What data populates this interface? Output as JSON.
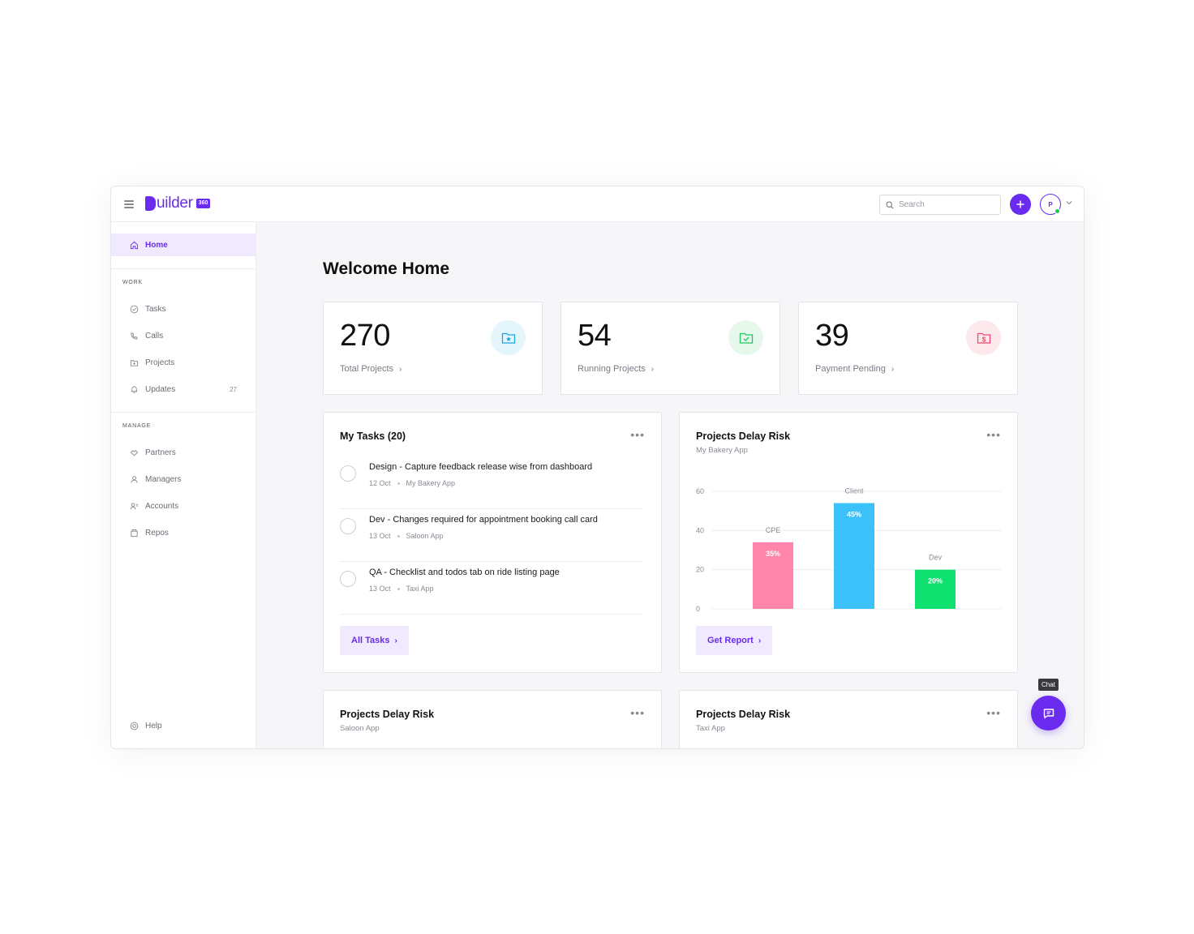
{
  "app": {
    "brand_name": "uilder",
    "brand_badge": "360",
    "brand_color": "#6a2bef"
  },
  "header": {
    "search_placeholder": "Search",
    "avatar_initial": "P"
  },
  "sidebar": {
    "home_label": "Home",
    "work_title": "WORK",
    "work_items": [
      {
        "label": "Tasks",
        "icon": "check-circle-icon"
      },
      {
        "label": "Calls",
        "icon": "phone-icon"
      },
      {
        "label": "Projects",
        "icon": "folder-icon"
      },
      {
        "label": "Updates",
        "icon": "bell-icon",
        "count": "27"
      }
    ],
    "manage_title": "MANAGE",
    "manage_items": [
      {
        "label": "Partners",
        "icon": "handshake-icon"
      },
      {
        "label": "Managers",
        "icon": "user-icon"
      },
      {
        "label": "Accounts",
        "icon": "users-icon"
      },
      {
        "label": "Repos",
        "icon": "archive-icon"
      }
    ],
    "help_label": "Help"
  },
  "main": {
    "welcome": "Welcome Home",
    "stats": [
      {
        "value": "270",
        "label": "Total Projects",
        "icon": "folder-star-icon",
        "icon_color": "#1aa7dd",
        "icon_bg": "#e5f5fc"
      },
      {
        "value": "54",
        "label": "Running Projects",
        "icon": "folder-check-icon",
        "icon_color": "#22c55e",
        "icon_bg": "#e6f8ec"
      },
      {
        "value": "39",
        "label": "Payment Pending",
        "icon": "folder-dollar-icon",
        "icon_color": "#ef476f",
        "icon_bg": "#fde8ec"
      }
    ],
    "tasks": {
      "title": "My Tasks (20)",
      "items": [
        {
          "title": "Design - Capture feedback release wise from dashboard",
          "date": "12 Oct",
          "project": "My Bakery App"
        },
        {
          "title": "Dev - Changes required for appointment booking call card",
          "date": "13 Oct",
          "project": "Saloon App"
        },
        {
          "title": "QA - Checklist and todos tab on ride listing page",
          "date": "13 Oct",
          "project": "Taxi App"
        }
      ],
      "button": "All Tasks"
    },
    "risk": {
      "title": "Projects Delay Risk",
      "subtitle": "My Bakery App",
      "button": "Get Report"
    },
    "risk2": {
      "title": "Projects Delay Risk",
      "subtitle": "Saloon App"
    },
    "risk3": {
      "title": "Projects Delay Risk",
      "subtitle": "Taxi App"
    }
  },
  "chart_data": {
    "type": "bar",
    "categories": [
      "CPE",
      "Client",
      "Dev"
    ],
    "values": [
      34,
      54,
      20
    ],
    "data_labels": [
      "35%",
      "45%",
      "20%"
    ],
    "colors": [
      "#ff85aa",
      "#3cc1fa",
      "#0fe070"
    ],
    "ylim": [
      0,
      60
    ],
    "yticks": [
      0,
      20,
      40,
      60
    ],
    "grid": true
  },
  "chat": {
    "tooltip": "Chat"
  }
}
